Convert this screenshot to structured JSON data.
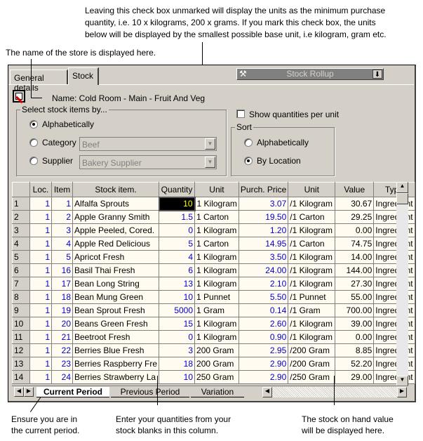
{
  "annotations": {
    "checkbox_note": [
      "Leaving this check box unmarked will display the units as the minimum purchase",
      "quantity, i.e. 10 x kilograms, 200 x grams.  If you mark this check box, the units",
      "below will be displayed by the smallest possible base unit, i.e kilogram, gram etc."
    ],
    "store_note": "The name of the store is displayed here.",
    "period_note": [
      "Ensure you are in",
      "the current period."
    ],
    "quantity_note": [
      "Enter your quantities from your",
      "stock blanks in this column."
    ],
    "value_note": [
      "The stock on hand value",
      "will be displayed here."
    ]
  },
  "tabs": [
    "General details",
    "Stock"
  ],
  "active_tab": "Stock",
  "rollup": {
    "label": "Stock Rollup",
    "icon": "wrench-icon"
  },
  "store_name": "Name: Cold Room - Main - Fruit And Veg",
  "select_by": {
    "title": "Select stock items by...",
    "options": [
      "Alphabetically",
      "Category",
      "Supplier"
    ],
    "selected": "Alphabetically",
    "category_value": "Beef",
    "supplier_value": "Bakery Supplier"
  },
  "show_qty_per_unit": {
    "label": "Show quantities per unit",
    "checked": false
  },
  "sort": {
    "title": "Sort",
    "options": [
      "Alphabetically",
      "By Location"
    ],
    "selected": "By Location"
  },
  "grid": {
    "columns": [
      "",
      "Loc.",
      "Item",
      "Stock item.",
      "Quantity",
      "Unit",
      "Purch. Price",
      "Unit",
      "Value",
      "Type"
    ],
    "rows": [
      [
        "1",
        "1",
        "1",
        "Alfalfa Sprouts",
        "10",
        "1 Kilogram",
        "3.07",
        "/1 Kilogram",
        "30.67",
        "Ingredient"
      ],
      [
        "2",
        "1",
        "2",
        "Apple Granny Smith",
        "1.5",
        "1 Carton",
        "19.50",
        "/1 Carton",
        "29.25",
        "Ingredient"
      ],
      [
        "3",
        "1",
        "3",
        "Apple Peeled, Cored.",
        "0",
        "1 Kilogram",
        "1.20",
        "/1 Kilogram",
        "0.00",
        "Ingredient"
      ],
      [
        "4",
        "1",
        "4",
        "Apple Red Delicious",
        "5",
        "1 Carton",
        "14.95",
        "/1 Carton",
        "74.75",
        "Ingredient"
      ],
      [
        "5",
        "1",
        "5",
        "Apricot Fresh",
        "4",
        "1 Kilogram",
        "3.50",
        "/1 Kilogram",
        "14.00",
        "Ingredient"
      ],
      [
        "6",
        "1",
        "16",
        "Basil Thai Fresh",
        "6",
        "1 Kilogram",
        "24.00",
        "/1 Kilogram",
        "144.00",
        "Ingredient"
      ],
      [
        "7",
        "1",
        "17",
        "Bean Long String",
        "13",
        "1 Kilogram",
        "2.10",
        "/1 Kilogram",
        "27.30",
        "Ingredient"
      ],
      [
        "8",
        "1",
        "18",
        "Bean Mung Green",
        "10",
        "1 Punnet",
        "5.50",
        "/1 Punnet",
        "55.00",
        "Ingredient"
      ],
      [
        "9",
        "1",
        "19",
        "Bean Sprout Fresh",
        "5000",
        "1 Gram",
        "0.14",
        "/1 Gram",
        "700.00",
        "Ingredient"
      ],
      [
        "10",
        "1",
        "20",
        "Beans Green Fresh",
        "15",
        "1 Kilogram",
        "2.60",
        "/1 Kilogram",
        "39.00",
        "Ingredient"
      ],
      [
        "11",
        "1",
        "21",
        "Beetroot Fresh",
        "0",
        "1 Kilogram",
        "0.90",
        "/1 Kilogram",
        "0.00",
        "Ingredient"
      ],
      [
        "12",
        "1",
        "22",
        "Berries Blue Fresh",
        "3",
        "200 Gram",
        "2.95",
        "/200 Gram",
        "8.85",
        "Ingredient"
      ],
      [
        "13",
        "1",
        "23",
        "Berries Raspberry Fre",
        "18",
        "200 Gram",
        "2.90",
        "/200 Gram",
        "52.20",
        "Ingredient"
      ],
      [
        "14",
        "1",
        "24",
        "Berries Strawberry La",
        "10",
        "250 Gram",
        "2.90",
        "/250 Gram",
        "29.00",
        "Ingredient"
      ]
    ]
  },
  "period_tabs": [
    "Current Period",
    "Previous Period",
    "Variation"
  ],
  "active_period": "Current Period"
}
